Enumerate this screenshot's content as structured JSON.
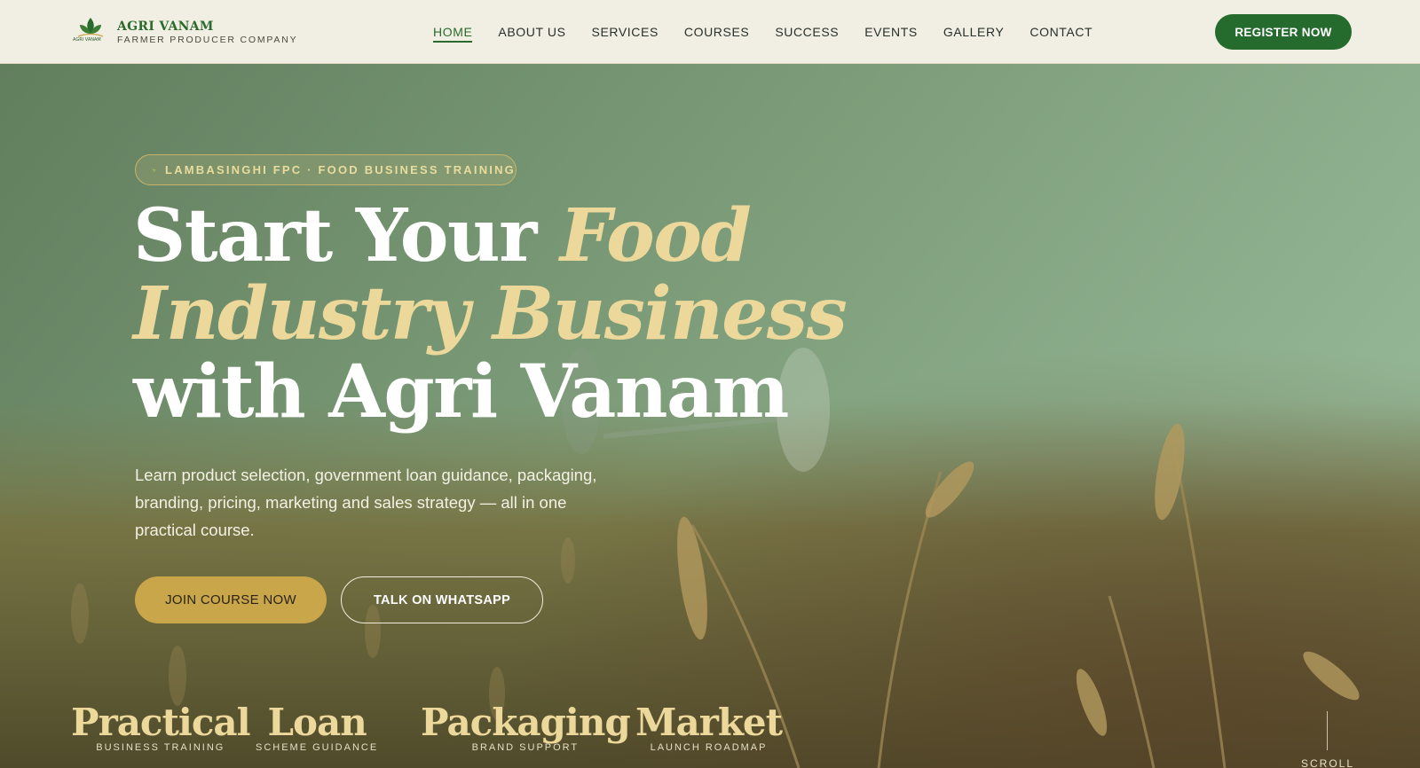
{
  "brand": {
    "name": "AGRI VANAM",
    "tagline": "FARMER PRODUCER COMPANY",
    "mark_text": "AGRI VANAM",
    "colors": {
      "primary": "#256b2e",
      "gold": "#c9a64a",
      "header_bg": "#f1efe4"
    }
  },
  "nav": {
    "items": [
      {
        "label": "HOME",
        "active": true
      },
      {
        "label": "ABOUT US",
        "active": false
      },
      {
        "label": "SERVICES",
        "active": false
      },
      {
        "label": "COURSES",
        "active": false
      },
      {
        "label": "SUCCESS",
        "active": false
      },
      {
        "label": "EVENTS",
        "active": false
      },
      {
        "label": "GALLERY",
        "active": false
      },
      {
        "label": "CONTACT",
        "active": false
      }
    ],
    "register_label": "REGISTER NOW"
  },
  "hero": {
    "badge": {
      "icon": "sprout-icon",
      "text": "LAMBASINGHI FPC · FOOD BUSINESS TRAINING"
    },
    "headline": {
      "line1_white": "Start Your ",
      "line1_gold": "Food",
      "line2_gold": "Industry Business",
      "line3_white": "with Agri Vanam"
    },
    "subtext": "Learn product selection, government loan guidance, packaging, branding, pricing, marketing and sales strategy — all in one practical course.",
    "cta_primary": "JOIN COURSE NOW",
    "cta_secondary": "TALK ON WHATSAPP",
    "stats": [
      {
        "title": "Practical",
        "sub": "BUSINESS TRAINING"
      },
      {
        "title": "Loan",
        "sub": "SCHEME GUIDANCE"
      },
      {
        "title": "Packaging",
        "sub": "BRAND SUPPORT"
      },
      {
        "title": "Market",
        "sub": "LAUNCH ROADMAP"
      }
    ],
    "scroll_label": "SCROLL"
  }
}
